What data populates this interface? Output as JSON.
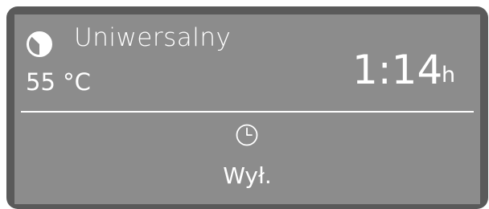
{
  "display": {
    "program_icon": "half-filled-circle-icon",
    "program_name": "Uniwersalny",
    "temperature": "55 °C",
    "remaining_time": "1:14",
    "time_unit": "h",
    "timer_icon": "clock-icon",
    "timer_status": "Wył.",
    "colors": {
      "bezel": "#5a5a5a",
      "screen_background": "#8c8c8c",
      "text": "#ffffff"
    }
  }
}
